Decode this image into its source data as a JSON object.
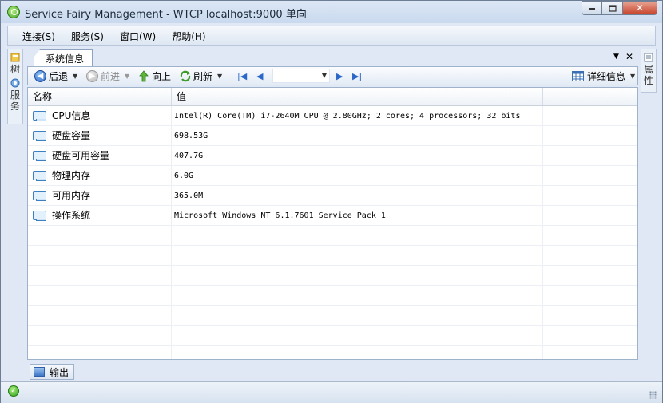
{
  "window": {
    "title": "Service Fairy Management - WTCP localhost:9000 单向",
    "controls": {
      "minimize": "▭",
      "maximize": "□",
      "close": "✕"
    }
  },
  "menu": {
    "items": [
      "连接(S)",
      "服务(S)",
      "窗口(W)",
      "帮助(H)"
    ]
  },
  "left_panel": {
    "tabs": [
      {
        "label": "树",
        "icon": "tree-icon"
      },
      {
        "label": "服务",
        "icon": "service-icon"
      }
    ]
  },
  "right_panel": {
    "tabs": [
      {
        "label": "属性",
        "icon": "properties-icon"
      }
    ]
  },
  "document": {
    "tab_label": "系统信息",
    "tab_menu_glyph": "▼",
    "tab_close_glyph": "✕"
  },
  "toolbar": {
    "back_label": "后退",
    "forward_label": "前进",
    "up_label": "向上",
    "refresh_label": "刷新",
    "combo_value": "",
    "view_label": "详细信息"
  },
  "grid": {
    "columns": [
      "名称",
      "值",
      ""
    ],
    "rows": [
      {
        "name": "CPU信息",
        "value": "Intel(R) Core(TM) i7-2640M CPU @ 2.80GHz; 2 cores; 4 processors; 32 bits"
      },
      {
        "name": "硬盘容量",
        "value": "698.53G"
      },
      {
        "name": "硬盘可用容量",
        "value": "407.7G"
      },
      {
        "name": "物理内存",
        "value": "6.0G"
      },
      {
        "name": "可用内存",
        "value": "365.0M"
      },
      {
        "name": "操作系统",
        "value": "Microsoft Windows NT 6.1.7601 Service Pack 1"
      }
    ],
    "empty_rows": 7
  },
  "bottom_tabs": {
    "output_label": "输出"
  },
  "colors": {
    "frame": "#dfe8f4",
    "title_gradient_top": "#dce7f5",
    "close_button": "#c7432a",
    "nav_blue": "#2c66c8",
    "status_ok": "#2f9e1e"
  }
}
